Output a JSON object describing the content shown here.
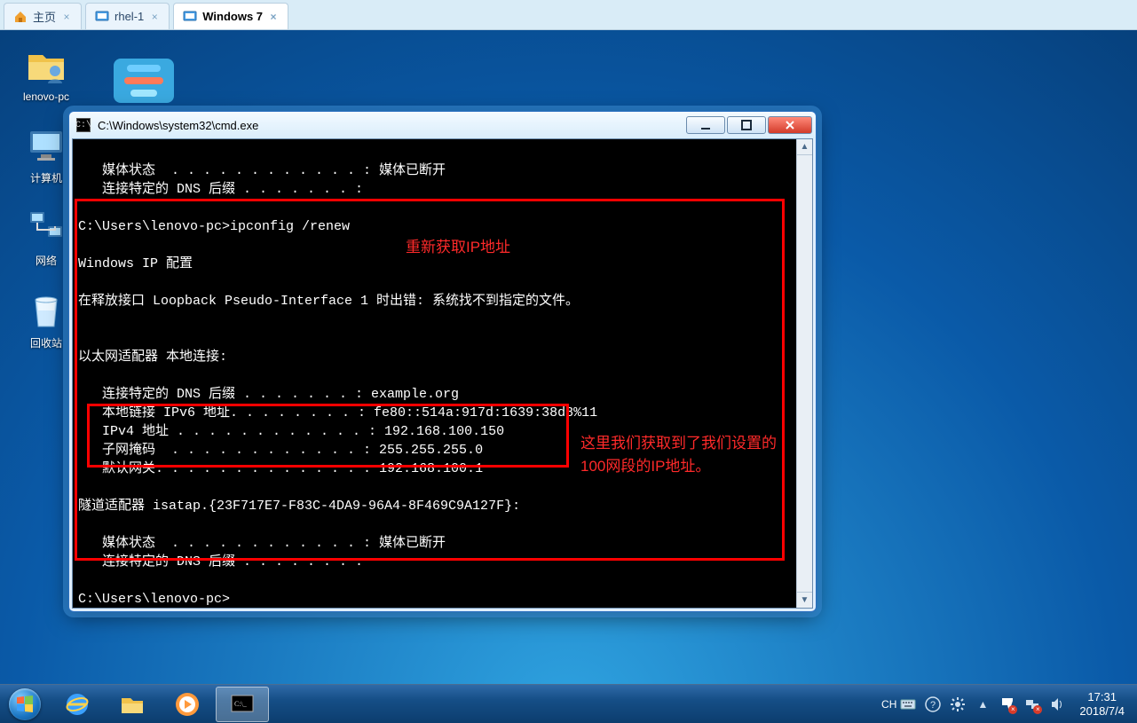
{
  "tabs": [
    {
      "label": "主页",
      "kind": "home"
    },
    {
      "label": "rhel-1",
      "kind": "linux"
    },
    {
      "label": "Windows 7",
      "kind": "windows",
      "active": true
    }
  ],
  "desktop": {
    "icons": [
      {
        "name": "user-folder",
        "label": "lenovo-pc"
      },
      {
        "name": "computer",
        "label": "计算机"
      },
      {
        "name": "network",
        "label": "网络"
      },
      {
        "name": "recycle-bin",
        "label": "回收站"
      }
    ]
  },
  "window": {
    "title": "C:\\Windows\\system32\\cmd.exe",
    "min_tip": "Minimize",
    "max_tip": "Maximize",
    "close_tip": "Close"
  },
  "terminal": {
    "lines": [
      "",
      "   媒体状态  . . . . . . . . . . . . : 媒体已断开",
      "   连接特定的 DNS 后缀 . . . . . . . :",
      "",
      "C:\\Users\\lenovo-pc>ipconfig /renew",
      "",
      "Windows IP 配置",
      "",
      "在释放接口 Loopback Pseudo-Interface 1 时出错: 系统找不到指定的文件。",
      "",
      "",
      "以太网适配器 本地连接:",
      "",
      "   连接特定的 DNS 后缀 . . . . . . . : example.org",
      "   本地链接 IPv6 地址. . . . . . . . : fe80::514a:917d:1639:38d8%11",
      "   IPv4 地址 . . . . . . . . . . . . : 192.168.100.150",
      "   子网掩码  . . . . . . . . . . . . : 255.255.255.0",
      "   默认网关. . . . . . . . . . . . . : 192.168.100.1",
      "",
      "隧道适配器 isatap.{23F717E7-F83C-4DA9-96A4-8F469C9A127F}:",
      "",
      "   媒体状态  . . . . . . . . . . . . : 媒体已断开",
      "   连接特定的 DNS 后缀 . . . . . . . :",
      "",
      "C:\\Users\\lenovo-pc>"
    ],
    "prompt": "C:\\Users\\lenovo-pc>"
  },
  "annotations": {
    "a1": "重新获取IP地址",
    "a2": "这里我们获取到了我们设置的100网段的IP地址。"
  },
  "taskbar": {
    "buttons": [
      {
        "name": "ie",
        "tip": "Internet Explorer"
      },
      {
        "name": "explorer",
        "tip": "Windows Explorer"
      },
      {
        "name": "wmp",
        "tip": "Windows Media Player"
      },
      {
        "name": "cmd",
        "tip": "cmd.exe",
        "active": true
      }
    ],
    "ime": "CH",
    "clock_time": "17:31",
    "clock_date": "2018/7/4"
  }
}
